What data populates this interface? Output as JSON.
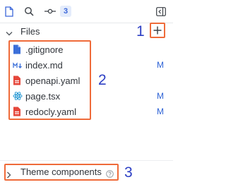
{
  "toolbar": {
    "icons": [
      "file-icon",
      "search-icon",
      "git-commit-icon",
      "sidebar-collapse-icon"
    ],
    "changes_count": "3"
  },
  "files_section": {
    "title": "Files",
    "add_icon": "plus-icon"
  },
  "files": [
    {
      "name": ".gitignore",
      "status": "",
      "icon": "file-icon",
      "icon_color": "#3b6fd9"
    },
    {
      "name": "index.md",
      "status": "M",
      "icon": "markdown-icon",
      "icon_color": "#3b6fd9"
    },
    {
      "name": "openapi.yaml",
      "status": "",
      "icon": "yaml-icon",
      "icon_color": "#e5473b"
    },
    {
      "name": "page.tsx",
      "status": "M",
      "icon": "react-icon",
      "icon_color": "#2a9ad4"
    },
    {
      "name": "redocly.yaml",
      "status": "M",
      "icon": "yaml-icon",
      "icon_color": "#e5473b"
    }
  ],
  "theme_section": {
    "title": "Theme components",
    "help_icon": "help-circle-icon"
  },
  "annotations": [
    "1",
    "2",
    "3"
  ],
  "colors": {
    "highlight": "#ef6b3a",
    "annotation": "#2d3fc4",
    "modified": "#2e63d6",
    "badge_bg": "#e4ecfb"
  }
}
